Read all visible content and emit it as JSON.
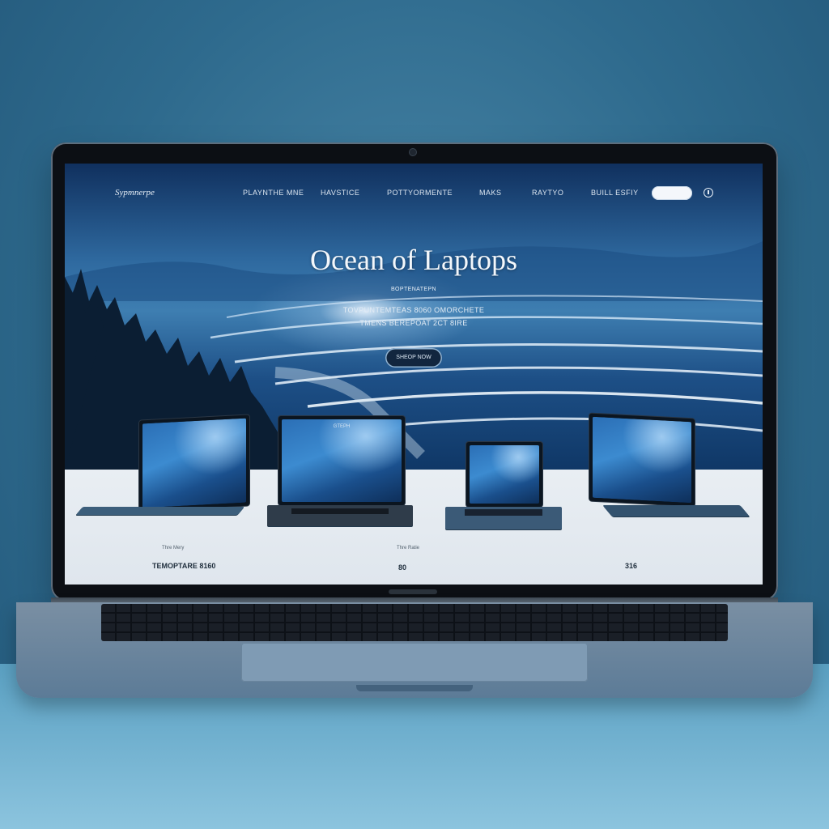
{
  "site": {
    "logo": "Sypmnerpe",
    "nav": [
      {
        "label": "PLAYNTHE MNE"
      },
      {
        "label": "HAVSTICE"
      },
      {
        "label": "POTTYORMENTE"
      },
      {
        "label": "MAKS"
      },
      {
        "label": "RAYTYO"
      },
      {
        "label": "BUILL ESFIY"
      }
    ],
    "nav_button_label": "",
    "user_icon": "user-icon"
  },
  "hero": {
    "title": "Ocean of Laptops",
    "kicker": "BOPTENATEPN",
    "subtitle_line1": "TOVPUNTEMTEAS 8060 OMORCHETE",
    "subtitle_line2": "TMENS BEREPOAT 2CT 8IRE",
    "cta_label": "SHEOP NOW"
  },
  "products": [
    {
      "caption": "Thre Mery",
      "price": "TEMOPTARE 8160"
    },
    {
      "caption": "GTEPH",
      "price": ""
    },
    {
      "caption": "Thre Ratie",
      "price": "80"
    },
    {
      "caption": "",
      "price": "316"
    }
  ],
  "colors": {
    "accent": "#1d4f86",
    "text_light": "#f3f7fb",
    "product_bg": "#e9eef3",
    "price_text": "#22313f"
  }
}
